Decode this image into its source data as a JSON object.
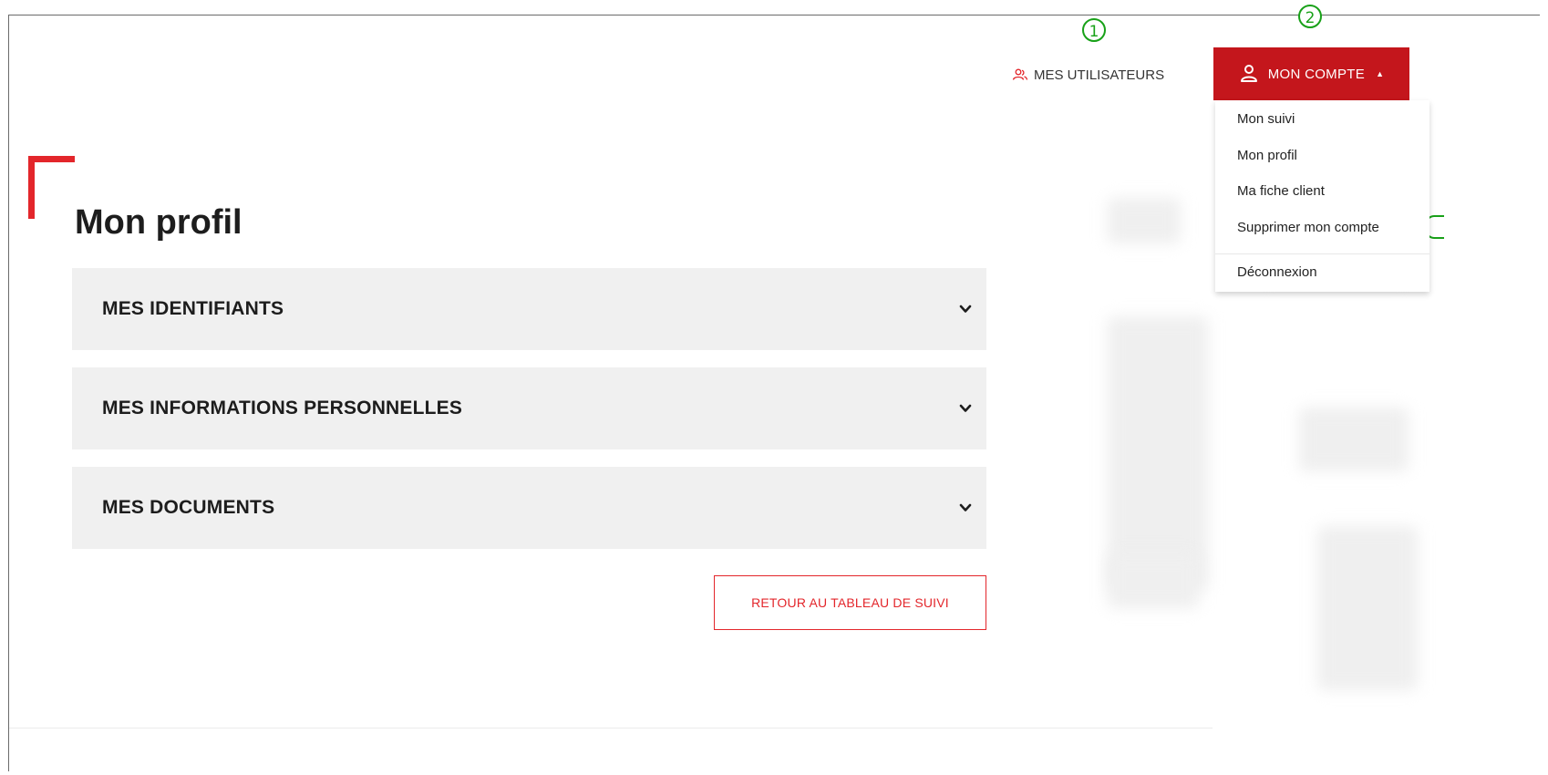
{
  "annotations": {
    "marker_1": "1",
    "marker_2": "2"
  },
  "header": {
    "users_link": "MES UTILISATEURS",
    "account_button": "MON COMPTE",
    "users_icon": "users-icon",
    "account_icon": "user-icon"
  },
  "account_menu": {
    "items": [
      "Mon suivi",
      "Mon profil",
      "Ma fiche client",
      "Supprimer mon compte",
      "Déconnexion"
    ]
  },
  "page": {
    "title": "Mon profil",
    "sections": [
      "MES IDENTIFIANTS",
      "MES INFORMATIONS PERSONNELLES",
      "MES DOCUMENTS"
    ],
    "back_button": "RETOUR AU TABLEAU DE SUIVI"
  },
  "colors": {
    "brand_red": "#c4161c",
    "accent_red": "#e3262b",
    "panel_gray": "#f0f0f0",
    "marker_green": "#18a118"
  }
}
